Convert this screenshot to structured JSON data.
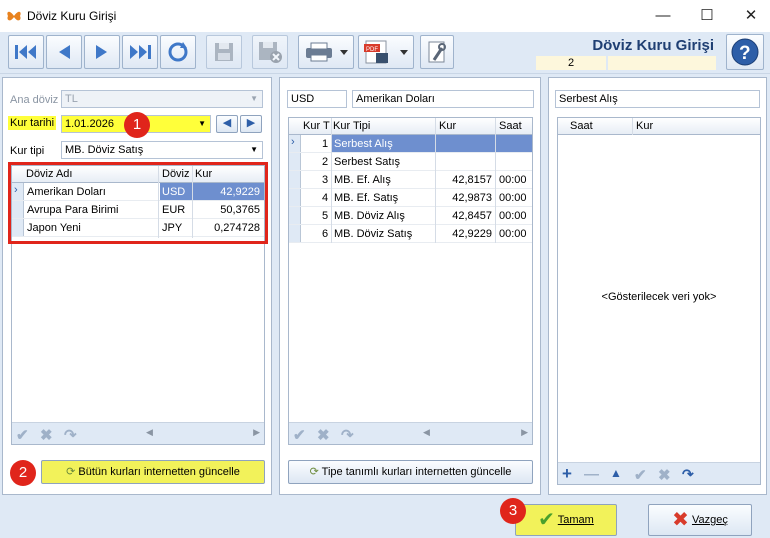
{
  "window": {
    "title": "Döviz Kuru Girişi",
    "minimize": "—",
    "maximize": "☐",
    "close": "✕"
  },
  "toolbar": {
    "heading": "Döviz Kuru Girişi",
    "record_no": "2"
  },
  "left": {
    "ana_doviz_label": "Ana döviz",
    "ana_doviz_value": "TL",
    "kur_tarihi_label": "Kur tarihi",
    "kur_tarihi_value": "1.01.2026",
    "kur_tipi_label": "Kur tipi",
    "kur_tipi_value": "MB. Döviz Satış",
    "columns": [
      "Döviz Adı",
      "Döviz",
      "Kur"
    ],
    "rows": [
      {
        "name": "Amerikan Doları",
        "code": "USD",
        "rate": "42,9229"
      },
      {
        "name": "Avrupa Para Birimi",
        "code": "EUR",
        "rate": "50,3765"
      },
      {
        "name": "Japon Yeni",
        "code": "JPY",
        "rate": "0,274728"
      }
    ],
    "update_button": "Bütün kurları internetten güncelle"
  },
  "middle": {
    "code": "USD",
    "name": "Amerikan Doları",
    "columns": [
      "Kur T",
      "Kur Tipi",
      "Kur",
      "Saat"
    ],
    "rows": [
      {
        "no": "1",
        "type": "Serbest Alış",
        "rate": "",
        "time": ""
      },
      {
        "no": "2",
        "type": "Serbest Satış",
        "rate": "",
        "time": ""
      },
      {
        "no": "3",
        "type": "MB. Ef. Alış",
        "rate": "42,8157",
        "time": "00:00"
      },
      {
        "no": "4",
        "type": "MB. Ef. Satış",
        "rate": "42,9873",
        "time": "00:00"
      },
      {
        "no": "5",
        "type": "MB. Döviz Alış",
        "rate": "42,8457",
        "time": "00:00"
      },
      {
        "no": "6",
        "type": "MB. Döviz Satış",
        "rate": "42,9229",
        "time": "00:00"
      }
    ],
    "update_button": "Tipe tanımlı kurları internetten güncelle"
  },
  "right": {
    "title": "Serbest Alış",
    "columns": [
      "Saat",
      "Kur"
    ],
    "empty": "<Gösterilecek veri yok>"
  },
  "footer": {
    "ok": "Tamam",
    "cancel": "Vazgeç"
  },
  "badges": [
    "1",
    "2",
    "3"
  ]
}
